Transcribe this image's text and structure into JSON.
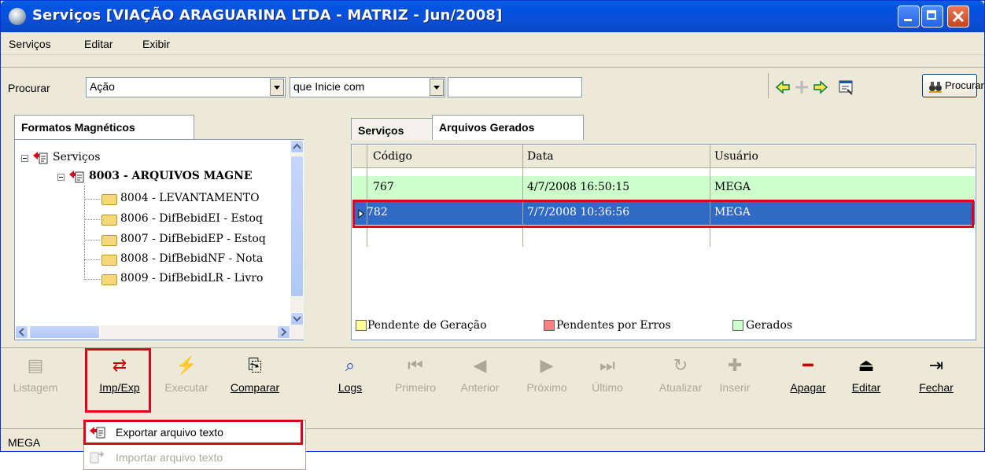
{
  "window": {
    "title": "Serviços [VIAÇÃO ARAGUARINA LTDA - MATRIZ - Jun/2008]",
    "controls": {
      "min": "minimize",
      "max": "maximize",
      "close": "close"
    }
  },
  "menubar": [
    "Serviços",
    "Editar",
    "Exibir"
  ],
  "search": {
    "label": "Procurar",
    "field": "Ação",
    "condition": "que Inicie com",
    "value": "",
    "button": "Procurar"
  },
  "left_panel": {
    "tab": "Formatos Magnéticos",
    "tree": [
      {
        "label": "Serviços",
        "level": 0
      },
      {
        "label": "8003 - ARQUIVOS MAGNE",
        "level": 1
      },
      {
        "label": "8004 - LEVANTAMENTO",
        "level": 2
      },
      {
        "label": "8006 - DifBebidEI - Estoq",
        "level": 2
      },
      {
        "label": "8007 - DifBebidEP - Estoq",
        "level": 2
      },
      {
        "label": "8008 - DifBebidNF - Nota",
        "level": 2
      },
      {
        "label": "8009 - DifBebidLR - Livro",
        "level": 2
      }
    ]
  },
  "right_panel": {
    "tabs": [
      "Serviços",
      "Arquivos Gerados"
    ],
    "active_tab": "Arquivos Gerados",
    "columns": [
      "Código",
      "Data",
      "Usuário"
    ],
    "rows": [
      {
        "codigo": "767",
        "data": "4/7/2008 16:50:15",
        "usuario": "MEGA"
      },
      {
        "codigo": "782",
        "data": "7/7/2008 10:36:56",
        "usuario": "MEGA"
      }
    ],
    "legend": [
      {
        "label": "Pendente de Geração",
        "color": "#ffff99"
      },
      {
        "label": "Pendentes por Erros",
        "color": "#ff8080"
      },
      {
        "label": "Gerados",
        "color": "#ccffcc"
      }
    ]
  },
  "bottom_toolbar": [
    {
      "label": "Listagem",
      "enabled": false,
      "icon": "report-icon"
    },
    {
      "label": "Imp/Exp",
      "enabled": true,
      "icon": "import-export-icon"
    },
    {
      "label": "Executar",
      "enabled": false,
      "icon": "execute-icon"
    },
    {
      "label": "Comparar",
      "enabled": true,
      "icon": "compare-icon"
    },
    {
      "label": "Logs",
      "enabled": true,
      "icon": "magnifier-icon"
    },
    {
      "label": "Primeiro",
      "enabled": false,
      "icon": "first-icon"
    },
    {
      "label": "Anterior",
      "enabled": false,
      "icon": "previous-icon"
    },
    {
      "label": "Próximo",
      "enabled": false,
      "icon": "next-icon"
    },
    {
      "label": "Último",
      "enabled": false,
      "icon": "last-icon"
    },
    {
      "label": "Atualizar",
      "enabled": false,
      "icon": "refresh-icon"
    },
    {
      "label": "Inserir",
      "enabled": false,
      "icon": "insert-icon"
    },
    {
      "label": "Apagar",
      "enabled": true,
      "icon": "delete-icon"
    },
    {
      "label": "Editar",
      "enabled": true,
      "icon": "edit-icon"
    },
    {
      "label": "Fechar",
      "enabled": true,
      "icon": "close-door-icon"
    }
  ],
  "status": {
    "user": "MEGA"
  },
  "popup_menu": [
    {
      "label": "Exportar arquivo texto",
      "enabled": true
    },
    {
      "label": "Importar arquivo texto",
      "enabled": false
    }
  ],
  "colors": {
    "accent_red": "#e0001a",
    "selection": "#316ac5",
    "gerado": "#ccffcc"
  }
}
